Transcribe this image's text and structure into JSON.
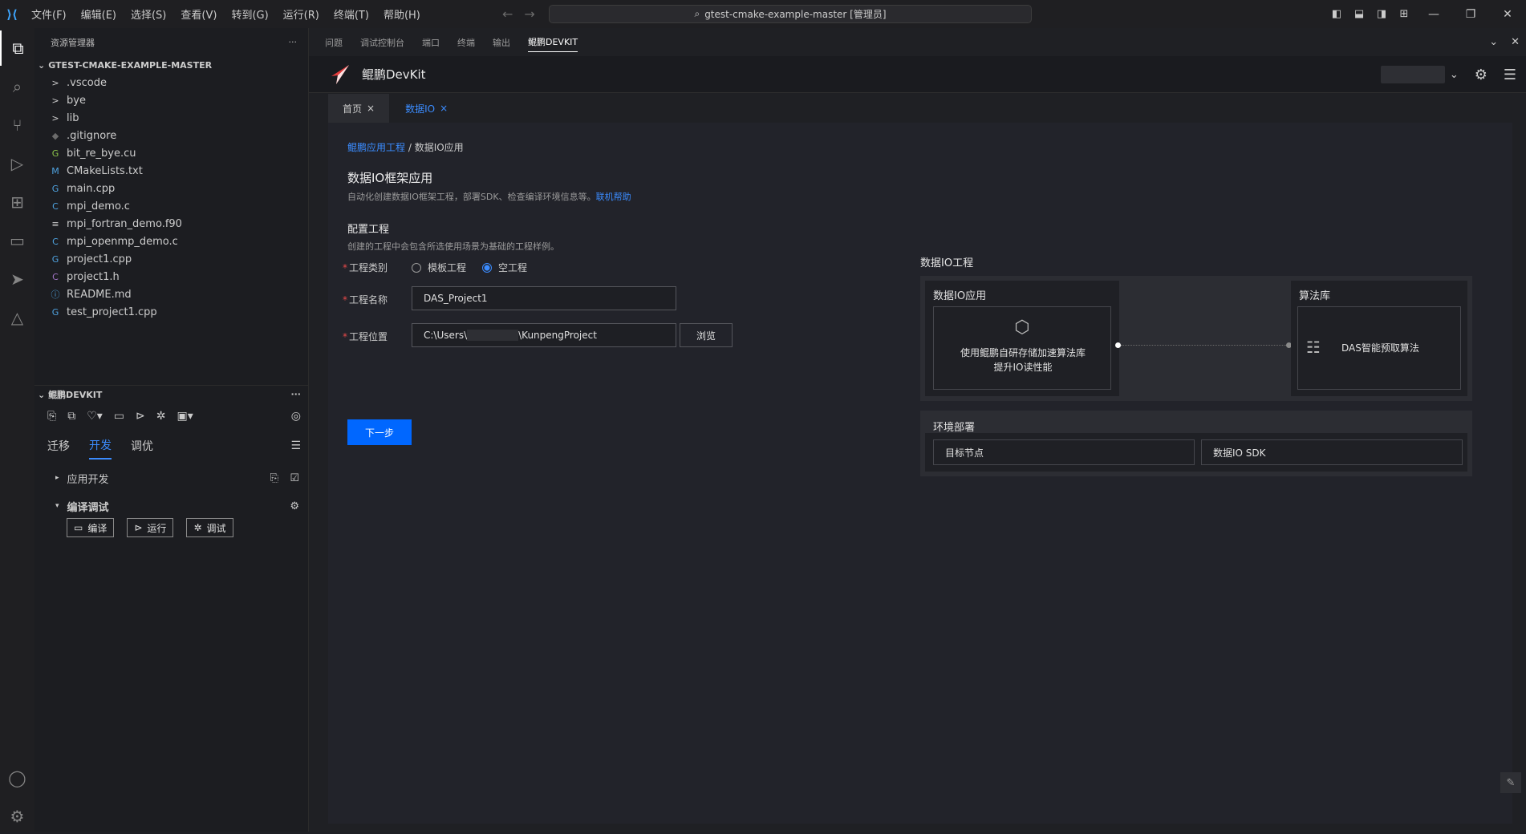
{
  "titlebar": {
    "menu": [
      "文件(F)",
      "编辑(E)",
      "选择(S)",
      "查看(V)",
      "转到(G)",
      "运行(R)",
      "终端(T)",
      "帮助(H)"
    ],
    "search_text": "gtest-cmake-example-master [管理员]"
  },
  "explorer": {
    "header": "资源管理器",
    "root": "GTEST-CMAKE-EXAMPLE-MASTER",
    "items": [
      {
        "label": ".vscode",
        "icon": ">",
        "color": "#cccccc"
      },
      {
        "label": "bye",
        "icon": ">",
        "color": "#cccccc"
      },
      {
        "label": "lib",
        "icon": ">",
        "color": "#cccccc"
      },
      {
        "label": ".gitignore",
        "icon": "◆",
        "color": "#6b6b6b"
      },
      {
        "label": "bit_re_bye.cu",
        "icon": "G",
        "color": "#8bc34a"
      },
      {
        "label": "CMakeLists.txt",
        "icon": "M",
        "color": "#4fa3e0"
      },
      {
        "label": "main.cpp",
        "icon": "G",
        "color": "#4fa3e0"
      },
      {
        "label": "mpi_demo.c",
        "icon": "C",
        "color": "#4fa3e0"
      },
      {
        "label": "mpi_fortran_demo.f90",
        "icon": "≡",
        "color": "#cccccc"
      },
      {
        "label": "mpi_openmp_demo.c",
        "icon": "C",
        "color": "#4fa3e0"
      },
      {
        "label": "project1.cpp",
        "icon": "G",
        "color": "#4fa3e0"
      },
      {
        "label": "project1.h",
        "icon": "C",
        "color": "#a074c4"
      },
      {
        "label": "README.md",
        "icon": "ⓘ",
        "color": "#4fa3e0"
      },
      {
        "label": "test_project1.cpp",
        "icon": "G",
        "color": "#4fa3e0"
      }
    ]
  },
  "devkit_side": {
    "title": "鲲鹏DEVKIT",
    "tabs": [
      "迁移",
      "开发",
      "调优"
    ],
    "active_tab": "开发",
    "row1": "应用开发",
    "row2": "编译调试",
    "buttons": [
      "编译",
      "运行",
      "调试"
    ]
  },
  "panel": {
    "tabs": [
      "问题",
      "调试控制台",
      "端口",
      "终端",
      "输出",
      "鲲鹏DEVKIT"
    ],
    "active": "鲲鹏DEVKIT"
  },
  "devkit": {
    "name": "鲲鹏DevKit",
    "doc_tabs": [
      "首页",
      "数据IO"
    ],
    "breadcrumb_link": "鲲鹏应用工程",
    "breadcrumb_sep": " / ",
    "breadcrumb_current": "数据IO应用",
    "title": "数据IO框架应用",
    "subtitle": "自动化创建数据IO框架工程，部署SDK、检查编译环境信息等。",
    "help_link": "联机帮助",
    "config_title": "配置工程",
    "config_sub": "创建的工程中会包含所选使用场景为基础的工程样例。",
    "type_label": "工程类别",
    "type_options": [
      "模板工程",
      "空工程"
    ],
    "type_selected": "空工程",
    "name_label": "工程名称",
    "name_value": "DAS_Project1",
    "loc_label": "工程位置",
    "loc_prefix": "C:\\Users\\",
    "loc_suffix": "\\KunpengProject",
    "browse": "浏览",
    "next": "下一步",
    "diagram": {
      "title": "数据IO工程",
      "app_title": "数据IO应用",
      "app_desc_1": "使用鲲鹏自研存储加速算法库",
      "app_desc_2": "提升IO读性能",
      "lib_title": "算法库",
      "lib_item": "DAS智能预取算法",
      "env_title": "环境部署",
      "env_items": [
        "目标节点",
        "数据IO SDK"
      ]
    }
  }
}
